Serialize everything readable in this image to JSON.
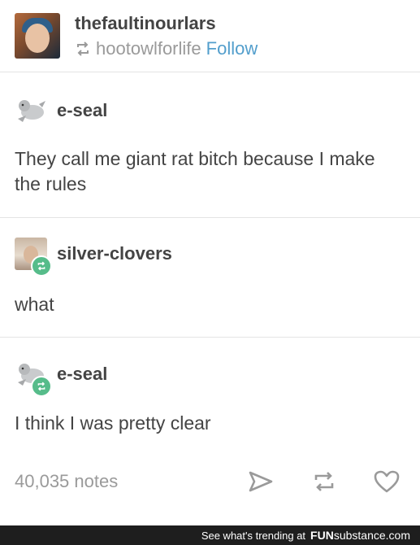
{
  "header": {
    "blog_name": "thefaultinourlars",
    "reblogged_from": "hootowlforlife",
    "follow_label": "Follow"
  },
  "thread": [
    {
      "user": "e-seal",
      "text": "They call me giant rat bitch because I make the rules",
      "reblog_badge": false
    },
    {
      "user": "silver-clovers",
      "text": "what",
      "reblog_badge": true
    },
    {
      "user": "e-seal",
      "text": "I think I was pretty clear",
      "reblog_badge": true
    }
  ],
  "footer": {
    "notes": "40,035 notes",
    "icons": [
      "share-icon",
      "reblog-icon",
      "like-icon"
    ]
  },
  "watermark": {
    "text": "See what's trending at",
    "brand_a": "FUN",
    "brand_b": "substance",
    "brand_c": ".com"
  },
  "colors": {
    "accent_blue": "#529ecc",
    "reblog_green": "#56bc8a",
    "text": "#444444",
    "muted": "#9a9a9a"
  }
}
